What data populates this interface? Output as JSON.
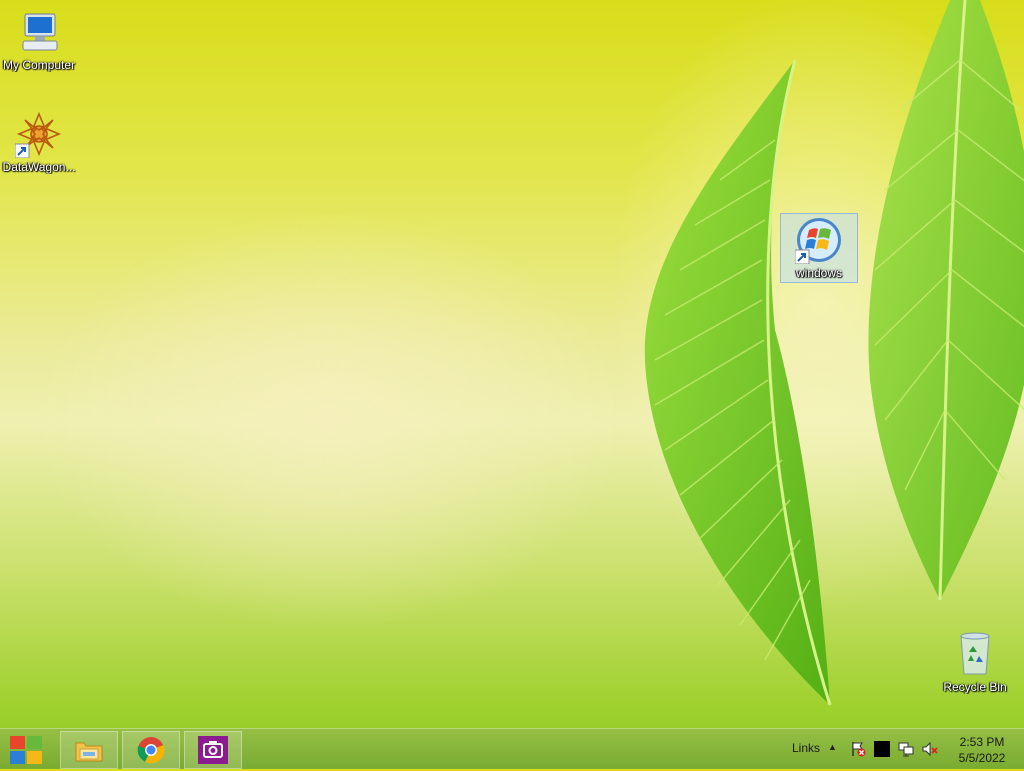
{
  "desktop": {
    "icons": [
      {
        "label": "My Computer",
        "icon": "computer-icon"
      },
      {
        "label": "DataWagon...",
        "icon": "datawagon-icon"
      },
      {
        "label": "windows",
        "icon": "windows-logo-icon"
      },
      {
        "label": "Recycle Bin",
        "icon": "recycle-bin-icon"
      }
    ]
  },
  "taskbar": {
    "start": {
      "icon": "start-icon"
    },
    "apps": [
      {
        "name": "File Explorer",
        "icon": "file-explorer-icon"
      },
      {
        "name": "Google Chrome",
        "icon": "chrome-icon"
      },
      {
        "name": "Camera",
        "icon": "camera-icon"
      }
    ],
    "links_label": "Links",
    "tray_icons": [
      "chevron-up-icon",
      "action-center-flag-icon",
      "black-square-icon",
      "network-icon",
      "volume-muted-icon"
    ],
    "clock": {
      "time": "2:53 PM",
      "date": "5/5/2022"
    }
  },
  "colors": {
    "taskbar": "#8cbf3a",
    "wallpaper_top": "#d8dd1a",
    "wallpaper_bottom": "#8cc622",
    "leaf": "#6ec41c"
  }
}
